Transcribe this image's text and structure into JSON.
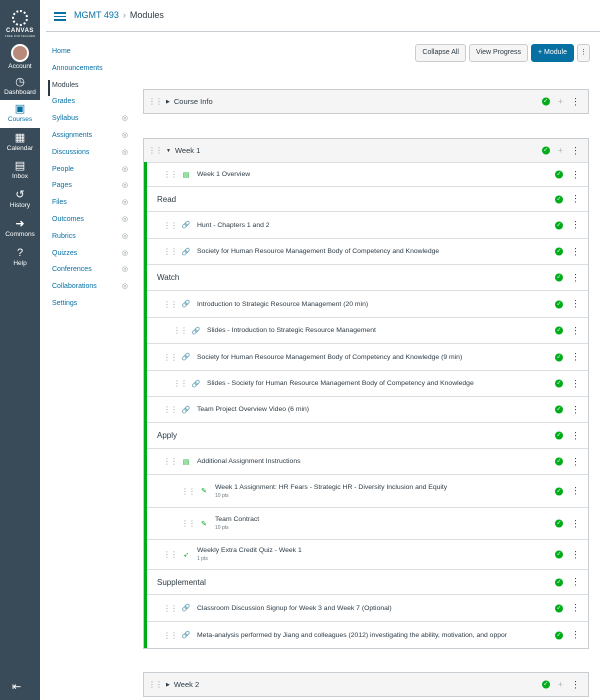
{
  "global_nav": {
    "logo_word": "CANVAS",
    "logo_sub": "FREE FOR TEACHER",
    "items": [
      {
        "label": "Account",
        "icon": "avatar-icon"
      },
      {
        "label": "Dashboard",
        "icon": "dashboard-icon"
      },
      {
        "label": "Courses",
        "icon": "courses-icon"
      },
      {
        "label": "Calendar",
        "icon": "calendar-icon"
      },
      {
        "label": "Inbox",
        "icon": "inbox-icon"
      },
      {
        "label": "History",
        "icon": "history-icon"
      },
      {
        "label": "Commons",
        "icon": "commons-icon"
      },
      {
        "label": "Help",
        "icon": "help-icon"
      }
    ]
  },
  "breadcrumb": {
    "course": "MGMT 493",
    "page": "Modules"
  },
  "course_nav": [
    {
      "label": "Home"
    },
    {
      "label": "Announcements"
    },
    {
      "label": "Modules"
    },
    {
      "label": "Grades"
    },
    {
      "label": "Syllabus"
    },
    {
      "label": "Assignments"
    },
    {
      "label": "Discussions"
    },
    {
      "label": "People"
    },
    {
      "label": "Pages"
    },
    {
      "label": "Files"
    },
    {
      "label": "Outcomes"
    },
    {
      "label": "Rubrics"
    },
    {
      "label": "Quizzes"
    },
    {
      "label": "Conferences"
    },
    {
      "label": "Collaborations"
    },
    {
      "label": "Settings"
    }
  ],
  "toolbar": {
    "collapse_all": "Collapse All",
    "view_progress": "View Progress",
    "add_module": "+ Module"
  },
  "modules": {
    "course_info": {
      "title": "Course Info"
    },
    "week1": {
      "title": "Week 1",
      "items": [
        {
          "title": "Week 1 Overview"
        },
        {
          "title": "Read"
        },
        {
          "title": "Hunt - Chapters 1 and 2"
        },
        {
          "title": "Society for Human Resource Management Body of Competency and Knowledge"
        },
        {
          "title": "Watch"
        },
        {
          "title": "Introduction to Strategic Resource Management (20 min)"
        },
        {
          "title": "Slides - Introduction to Strategic Resource Management"
        },
        {
          "title": "Society for Human Resource Management Body of Competency and Knowledge (9 min)"
        },
        {
          "title": "Slides - Society for Human Resource Management Body of Competency and Knowledge"
        },
        {
          "title": "Team Project Overview Video (6 min)"
        },
        {
          "title": "Apply"
        },
        {
          "title": "Additional Assignment Instructions"
        },
        {
          "title": "Week 1 Assignment: HR Fears - Strategic HR - Diversity Inclusion and Equity",
          "sub": "10 pts"
        },
        {
          "title": "Team Contract",
          "sub": "10 pts"
        },
        {
          "title": "Weekly Extra Credit Quiz - Week 1",
          "sub": "1 pts"
        },
        {
          "title": "Supplemental"
        },
        {
          "title": "Classroom Discussion Signup for Week 3 and Week 7 (Optional)"
        },
        {
          "title": "Meta-analysis performed by Jiang and colleagues (2012) investigating the ability, motivation, and oppor"
        }
      ]
    },
    "week2": {
      "title": "Week 2"
    }
  },
  "colors": {
    "accent": "#0770a3",
    "published": "#00ac18",
    "nav_bg": "#394b58"
  }
}
